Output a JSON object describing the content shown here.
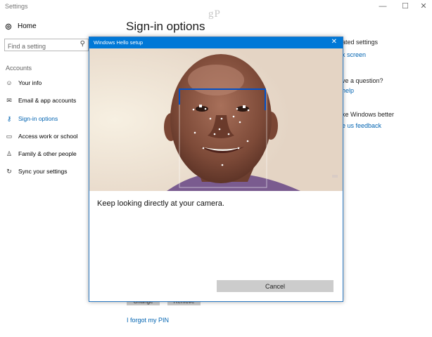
{
  "window": {
    "title": "Settings",
    "controls": {
      "minimize": "—",
      "maximize": "☐",
      "close": "✕"
    }
  },
  "watermark": "gP",
  "sidebar": {
    "home_label": "Home",
    "search_placeholder": "Find a setting",
    "section_title": "Accounts",
    "items": [
      {
        "label": "Your info",
        "icon": "person-card-icon"
      },
      {
        "label": "Email & app accounts",
        "icon": "mail-icon"
      },
      {
        "label": "Sign-in options",
        "icon": "key-icon",
        "active": true
      },
      {
        "label": "Access work or school",
        "icon": "briefcase-icon"
      },
      {
        "label": "Family & other people",
        "icon": "people-icon"
      },
      {
        "label": "Sync your settings",
        "icon": "sync-icon"
      }
    ]
  },
  "main": {
    "title": "Sign-in options",
    "right_panel": {
      "related_fragment": "ated settings",
      "lock_screen_fragment": "k screen",
      "question_fragment": "ve a question?",
      "help_fragment": "help",
      "better_fragment": "ke Windows better",
      "feedback_fragment": "e us feedback"
    },
    "pin_buttons": {
      "change": "Change",
      "remove": "Remove"
    },
    "forgot_pin": "I forgot my PIN"
  },
  "dialog": {
    "title": "Windows Hello setup",
    "close": "✕",
    "instruction": "Keep looking directly at your camera.",
    "cancel_label": "Cancel"
  },
  "colors": {
    "accent": "#0078d7",
    "link": "#0063b1",
    "button_grey": "#cccccc"
  }
}
